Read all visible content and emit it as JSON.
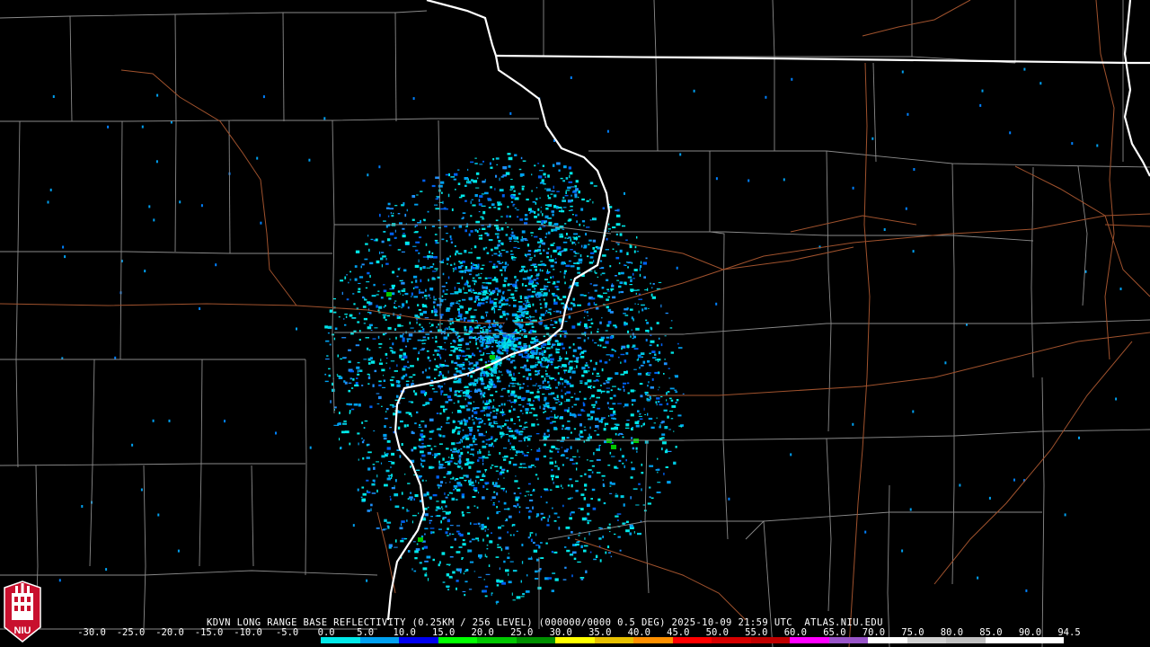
{
  "product": {
    "text": "KDVN LONG RANGE BASE REFLECTIVITY (0.25KM / 256 LEVEL) (000000/0000 0.5 DEG) 2025-10-09 21:59 UTC  ATLAS.NIU.EDU",
    "station": "KDVN",
    "product_name": "LONG RANGE BASE REFLECTIVITY",
    "resolution": "0.25KM / 256 LEVEL",
    "elevation": "0.5 DEG",
    "timestamp": "2025-10-09 21:59 UTC",
    "source": "ATLAS.NIU.EDU"
  },
  "logo": {
    "text": "NIU",
    "icon": "niu-huskie-tower-logo",
    "color": "#c8102e"
  },
  "scale": {
    "labels": [
      "-30.0",
      "-25.0",
      "-20.0",
      "-15.0",
      "-10.0",
      "-5.0",
      "0.0",
      "5.0",
      "10.0",
      "15.0",
      "20.0",
      "25.0",
      "30.0",
      "35.0",
      "40.0",
      "45.0",
      "50.0",
      "55.0",
      "60.0",
      "65.0",
      "70.0",
      "75.0",
      "80.0",
      "85.0",
      "90.0",
      "94.5"
    ],
    "colors": [
      "#000000",
      "#000000",
      "#000000",
      "#000000",
      "#000000",
      "#000000",
      "#00e8e8",
      "#00a0f0",
      "#0000f0",
      "#00ff00",
      "#00c800",
      "#009000",
      "#ffff00",
      "#e7c000",
      "#ff9000",
      "#ff0000",
      "#d60000",
      "#c00000",
      "#ff00ff",
      "#9955c9",
      "#ffffff",
      "#d0d0d0",
      "#c0c0c0",
      "#ffffff",
      "#ffffff"
    ]
  },
  "map": {
    "background": "#000000",
    "county_line_color": "#8a8a8a",
    "state_line_color": "#ffffff",
    "highway_color": "#a0522d",
    "radar_site": "KDVN"
  }
}
